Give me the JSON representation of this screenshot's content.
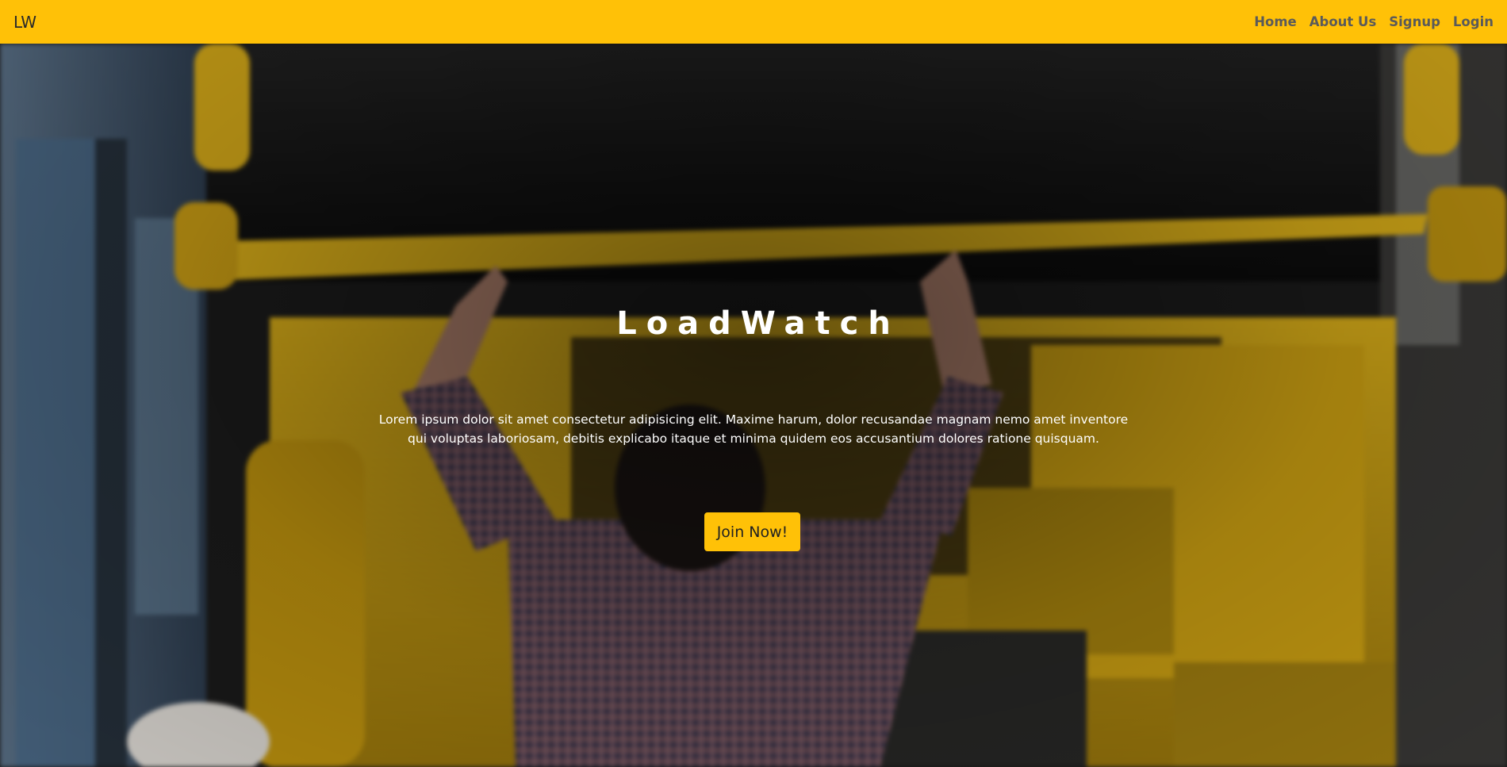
{
  "navbar": {
    "brand": "LW",
    "links": [
      "Home",
      "About Us",
      "Signup",
      "Login"
    ]
  },
  "hero": {
    "title": "LoadWatch",
    "text": "Lorem ipsum dolor sit amet consectetur adipisicing elit. Maxime harum, dolor recusandae magnam nemo amet inventore qui voluptas laboriosam, debitis explicabo itaque et minima quidem eos accusantium dolores ratione quisquam.",
    "button": "Join Now!",
    "background_image": "blurred photo of a mechanic lifting the yellow cab of a truck in a garage"
  },
  "colors": {
    "accent": "#ffc107",
    "hero_text": "#ffffff"
  }
}
